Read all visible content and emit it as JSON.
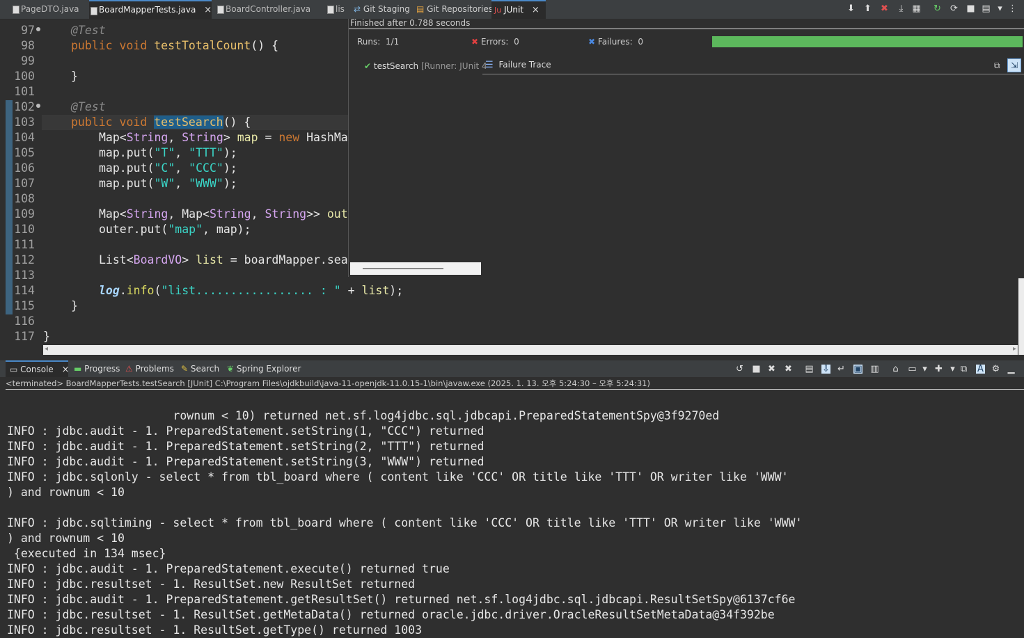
{
  "editor_tabs": [
    {
      "label": "PageDTO.java",
      "active": false
    },
    {
      "label": "BoardMapperTests.java",
      "active": true,
      "close": "×"
    },
    {
      "label": "BoardController.java",
      "active": false
    },
    {
      "label": "lis",
      "active": false
    }
  ],
  "junit_tabs": [
    {
      "label": "Git Staging"
    },
    {
      "label": "Git Repositories"
    },
    {
      "label": "JUnit",
      "close": "×"
    }
  ],
  "junit": {
    "finished": "Finished after 0.788 seconds",
    "runs_label": "Runs:",
    "runs_value": "1/1",
    "errors_label": "Errors:",
    "errors_value": "0",
    "failures_label": "Failures:",
    "failures_value": "0",
    "progress": 1.0,
    "progress_color": "#5cb85c",
    "test_item": "testSearch",
    "test_runner": "[Runner: JUnit 4",
    "failure_trace": "Failure Trace"
  },
  "code_lines": {
    "numbers": [
      "97",
      "98",
      "99",
      "100",
      "101",
      "102",
      "103",
      "104",
      "105",
      "106",
      "107",
      "108",
      "109",
      "110",
      "111",
      "112",
      "113",
      "114",
      "115",
      "116",
      "117"
    ]
  },
  "code": {
    "l97_ann": "@Test",
    "l98_kw": "public void",
    "l98_m": "testTotalCount",
    "l98_rest": "() {",
    "l100": "}",
    "l102_ann": "@Test",
    "l103_kw": "public void",
    "l103_m": "testSearch",
    "l103_rest": "() {",
    "l104_a": "Map<",
    "l104_t1": "String",
    "l104_b": ", ",
    "l104_t2": "String",
    "l104_c": "> ",
    "l104_v": "map",
    "l104_d": " = ",
    "l104_new": "new",
    "l104_e": " HashMa",
    "put_prefix": "map.put(",
    "l105_k": "\"T\"",
    "l105_v": "\"TTT\"",
    "l106_k": "\"C\"",
    "l106_v": "\"CCC\"",
    "l107_k": "\"W\"",
    "l107_v": "\"WWW\"",
    "comma": ", ",
    "close": ");",
    "l109_a": "Map<",
    "l109_t1": "String",
    "l109_b": ", Map<",
    "l109_t2": "String",
    "l109_c": ", ",
    "l109_t3": "String",
    "l109_d": ">> ",
    "l109_v": "out",
    "l110_a": "outer.put(",
    "l110_s": "\"map\"",
    "l110_b": ", map);",
    "l112_a": "List<",
    "l112_t": "BoardVO",
    "l112_b": "> ",
    "l112_v": "list",
    "l112_c": " = boardMapper.sea",
    "l114_log": "log",
    "l114_a": ".",
    "l114_m": "info",
    "l114_b": "(",
    "l114_s": "\"list................. : \"",
    "l114_c": " + ",
    "l114_v": "list",
    "l114_d": ");",
    "l115": "}",
    "l117": "}"
  },
  "console_tabs": [
    {
      "label": "Console",
      "close": "×"
    },
    {
      "label": "Progress"
    },
    {
      "label": "Problems"
    },
    {
      "label": "Search"
    },
    {
      "label": "Spring Explorer"
    }
  ],
  "console": {
    "status": "<terminated> BoardMapperTests.testSearch [JUnit] C:\\Program Files\\ojdkbuild\\java-11-openjdk-11.0.15-1\\bin\\javaw.exe  (2025. 1. 13. 오후 5:24:30 – 오후 5:24:31)",
    "lines": [
      "                        rownum < 10) returned net.sf.log4jdbc.sql.jdbcapi.PreparedStatementSpy@3f9270ed",
      "INFO : jdbc.audit - 1. PreparedStatement.setString(1, \"CCC\") returned",
      "INFO : jdbc.audit - 1. PreparedStatement.setString(2, \"TTT\") returned",
      "INFO : jdbc.audit - 1. PreparedStatement.setString(3, \"WWW\") returned",
      "INFO : jdbc.sqlonly - select * from tbl_board where ( content like 'CCC' OR title like 'TTT' OR writer like 'WWW'",
      ") and rownum < 10",
      "",
      "INFO : jdbc.sqltiming - select * from tbl_board where ( content like 'CCC' OR title like 'TTT' OR writer like 'WWW'",
      ") and rownum < 10",
      " {executed in 134 msec}",
      "INFO : jdbc.audit - 1. PreparedStatement.execute() returned true",
      "INFO : jdbc.resultset - 1. ResultSet.new ResultSet returned",
      "INFO : jdbc.audit - 1. PreparedStatement.getResultSet() returned net.sf.log4jdbc.sql.jdbcapi.ResultSetSpy@6137cf6e",
      "INFO : jdbc.resultset - 1. ResultSet.getMetaData() returned oracle.jdbc.driver.OracleResultSetMetaData@34f392be",
      "INFO : jdbc.resultset - 1. ResultSet.getType() returned 1003"
    ]
  }
}
